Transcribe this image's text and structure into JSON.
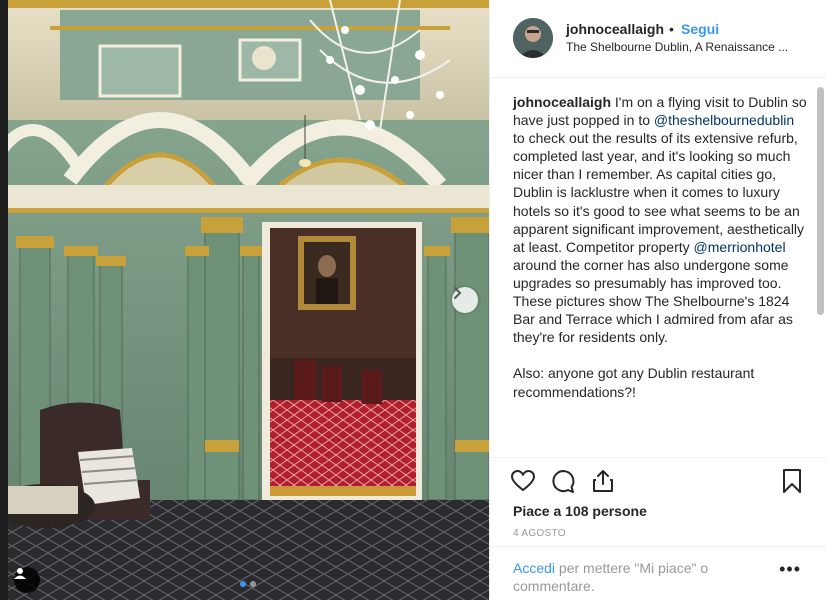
{
  "post": {
    "username": "johnoceallaigh",
    "separator": "•",
    "follow_label": "Segui",
    "location": "The Shelbourne Dublin, A Renaissance ...",
    "caption": {
      "username": "johnoceallaigh",
      "part1": " I'm on a flying visit to Dublin so have just popped in to ",
      "mention1": "@theshelbournedublin",
      "part2": " to check out the results of its extensive refurb, completed last year, and it's looking so much nicer than I remember. As capital cities go, Dublin is lacklustre when it comes to luxury hotels so it's good to see what seems to be an apparent significant improvement, aesthetically at least. Competitor property ",
      "mention2": "@merrionhotel",
      "part3": " around the corner has also undergone some upgrades so presumably has improved too. These pictures show The Shelbourne's 1824 Bar and Terrace which I admired from afar as they're for residents only.",
      "part4": "Also: anyone got any Dublin restaurant recommendations?!"
    },
    "likes": "Piace a 108 persone",
    "date": "4 AGOSTO",
    "login_link": "Accedi",
    "login_rest": " per mettere \"Mi piace\" o commentare.",
    "more_label": "•••",
    "carousel": {
      "slides": 2,
      "active": 1
    }
  },
  "icons": {
    "like": "heart-icon",
    "comment": "comment-icon",
    "share": "share-icon",
    "save": "bookmark-icon",
    "next": "chevron-right-icon",
    "tag": "user-tag-icon"
  },
  "colors": {
    "link_blue": "#3897f0",
    "mention": "#003569",
    "text": "#262626",
    "muted": "#999999",
    "wall_green": "#7fa08a",
    "gold": "#c9a13b"
  }
}
